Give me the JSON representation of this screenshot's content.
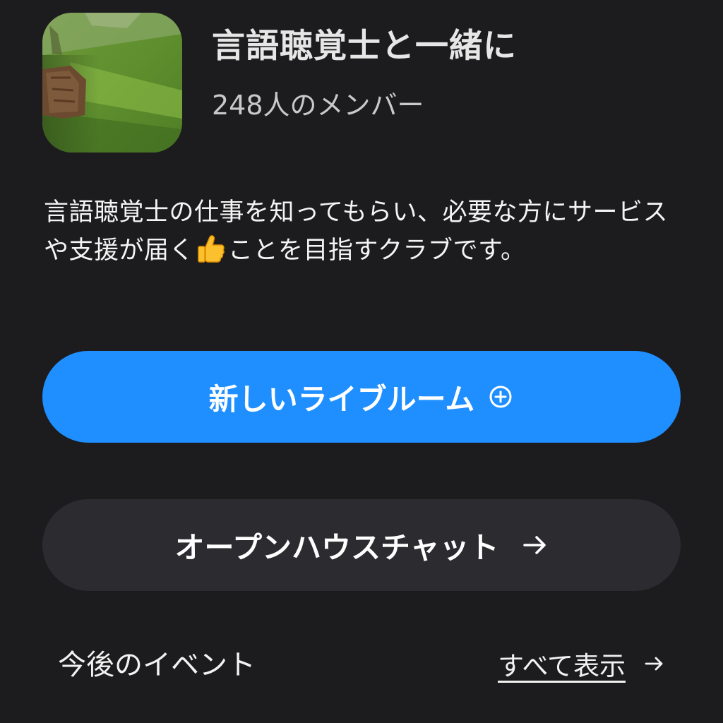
{
  "club": {
    "title": "言語聴覚士と一緒に",
    "members": "248人のメンバー",
    "description_part1": "言語聴覚士の仕事を知ってもらい、必要な方にサービスや支援が届く",
    "thumbs_icon": "thumbs-up-icon",
    "description_part2": "ことを目指すクラブです。"
  },
  "actions": {
    "new_live_room_label": "新しいライブルーム",
    "new_live_room_icon": "plus-circle-icon",
    "open_house_chat_label": "オープンハウスチャット",
    "open_house_chat_icon": "arrow-right-icon"
  },
  "events": {
    "section_title": "今後のイベント",
    "see_all_label": "すべて表示",
    "see_all_icon": "arrow-right-icon"
  },
  "colors": {
    "background": "#1c1c1e",
    "accent": "#1f8fff",
    "secondary_button": "#2b2b30"
  }
}
